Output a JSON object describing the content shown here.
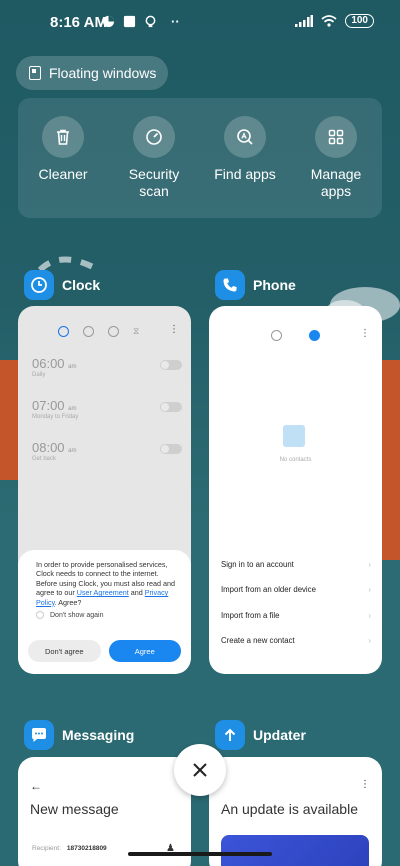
{
  "status_bar": {
    "time": "8:16 AM",
    "battery": "100"
  },
  "floating_windows": {
    "label": "Floating windows"
  },
  "quick_actions": [
    {
      "label": "Cleaner",
      "icon": "trash-icon"
    },
    {
      "label": "Security scan",
      "icon": "speedometer-icon"
    },
    {
      "label": "Find apps",
      "icon": "search-apps-icon"
    },
    {
      "label": "Manage apps",
      "icon": "grid-icon"
    }
  ],
  "apps": {
    "clock": {
      "name": "Clock",
      "alarms": [
        {
          "time": "06:00",
          "ampm": "am",
          "sub": "Daily"
        },
        {
          "time": "07:00",
          "ampm": "am",
          "sub": "Monday to Friday"
        },
        {
          "time": "08:00",
          "ampm": "am",
          "sub": "Get back"
        }
      ],
      "consent": {
        "text_before": "In order to provide personalised services, Clock needs to connect to the internet. Before using Clock, you must also read and agree to our ",
        "link_user_agreement": "User Agreement",
        "and": " and ",
        "link_privacy": "Privacy Policy",
        "text_after": ". Agree?",
        "dont_show": "Don't show again",
        "dont_agree": "Don't agree",
        "agree": "Agree"
      }
    },
    "phone": {
      "name": "Phone",
      "no_contacts": "No contacts",
      "rows": [
        "Sign in to an account",
        "Import from an older device",
        "Import from a file",
        "Create a new contact"
      ]
    },
    "messaging": {
      "name": "Messaging",
      "title": "New message",
      "recipient_label": "Recipient:",
      "recipient_value": "18730218809"
    },
    "updater": {
      "name": "Updater",
      "title": "An update is available"
    }
  },
  "colors": {
    "accent": "#1a86ef",
    "app_icon_bg": "#1f8fe6"
  }
}
